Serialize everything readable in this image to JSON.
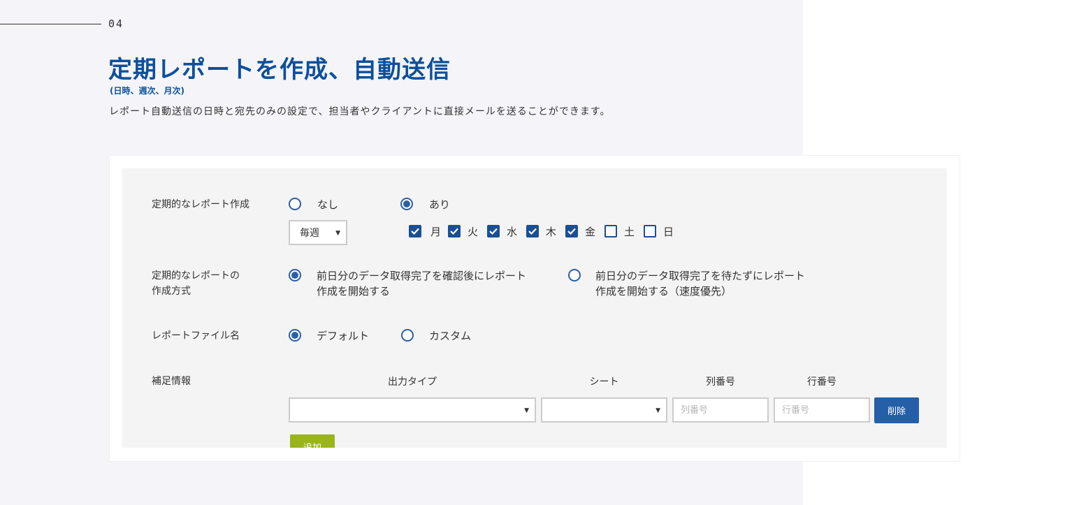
{
  "section": {
    "number": "04",
    "title": "定期レポートを作成、自動送信",
    "subtitle": "(日時、週次、月次)",
    "description": "レポート自動送信の日時と宛先のみの設定で、担当者やクライアントに直接メールを送ることができます。"
  },
  "form": {
    "periodic_report": {
      "label": "定期的なレポート作成",
      "options": [
        {
          "label": "なし",
          "checked": false
        },
        {
          "label": "あり",
          "checked": true
        }
      ],
      "frequency_value": "毎週",
      "days": [
        {
          "label": "月",
          "checked": true
        },
        {
          "label": "火",
          "checked": true
        },
        {
          "label": "水",
          "checked": true
        },
        {
          "label": "木",
          "checked": true
        },
        {
          "label": "金",
          "checked": true
        },
        {
          "label": "土",
          "checked": false
        },
        {
          "label": "日",
          "checked": false
        }
      ]
    },
    "creation_method": {
      "label_line1": "定期的なレポートの",
      "label_line2": "作成方式",
      "options": [
        {
          "line1": "前日分のデータ取得完了を確認後にレポート",
          "line2": "作成を開始する",
          "checked": true
        },
        {
          "line1": "前日分のデータ取得完了を待たずにレポート",
          "line2": "作成を開始する（速度優先）",
          "checked": false
        }
      ]
    },
    "file_name": {
      "label": "レポートファイル名",
      "options": [
        {
          "label": "デフォルト",
          "checked": true
        },
        {
          "label": "カスタム",
          "checked": false
        }
      ]
    },
    "supplementary": {
      "label": "補足情報",
      "columns": {
        "output_type": "出力タイプ",
        "sheet": "シート",
        "column_number": "列番号",
        "row_number": "行番号"
      },
      "row": {
        "output_type_value": "",
        "sheet_value": "",
        "column_placeholder": "列番号",
        "row_placeholder": "行番号",
        "delete_label": "削除"
      },
      "add_label": "追加"
    }
  },
  "colors": {
    "title_blue": "#0d4f9c",
    "radio_blue": "#2b5fa6",
    "checkbox_blue": "#1a4f93",
    "delete_button": "#255fa8",
    "add_button": "#9ab41b",
    "left_background": "#f5f5f9",
    "panel_background": "#f4f4f4"
  }
}
